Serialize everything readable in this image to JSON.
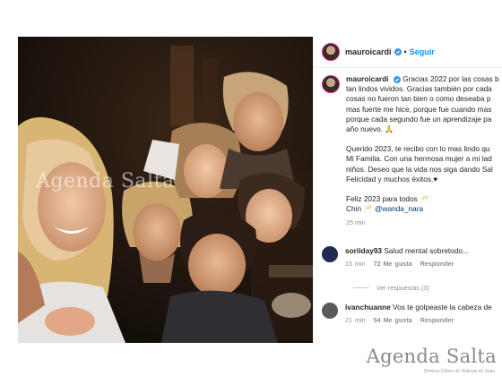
{
  "watermark": {
    "mid_text": "Agenda Salta",
    "logo_text": "Agenda Salta",
    "logo_sub": "Síntesis Online de Noticias de Salta"
  },
  "post": {
    "header": {
      "username": "mauroicardi",
      "separator": "•",
      "follow_label": "Seguir"
    },
    "caption": {
      "username": "mauroicardi",
      "lines_p1": [
        "Gracias 2022 por las cosas b",
        "tan lindos vividos. Gracias también por cada",
        "cosas no fueron tan bien o como deseaba p",
        "mas fuerte me hice, porque fue cuando mas",
        "porque cada segundo fue un aprendizaje pa",
        "año nuevo."
      ],
      "pray_emoji": "🙏",
      "lines_p2": [
        "Querido 2023, te recibo con lo mas lindo qu",
        "Mi Familia. Con una hermosa mujer a mi lad",
        "niños. Deseo que la vida nos siga dando Sal",
        "Felicidad y muchos éxitos.♥"
      ],
      "line_p3_1": "Feliz 2023 para todos",
      "line_p3_1_emoji": "🥂",
      "line_p3_2_prefix": "Chin",
      "line_p3_2_emoji": "🥂",
      "line_p3_2_mention": "@wanda_nara",
      "time": "25 min"
    },
    "comments": [
      {
        "username": "soriiday93",
        "text": "Salud mental sobretodo...",
        "time": "15 min",
        "likes": "72 Me gusta",
        "reply": "Responder",
        "avatar_color": "#1f2b52"
      },
      {
        "username": "ivanchuanne",
        "text": "Vos te golpeaste la cabeza de",
        "time": "21 min",
        "likes": "54 Me gusta",
        "reply": "Responder",
        "avatar_color": "#5a5a5a"
      }
    ],
    "view_replies": "Ver respuestas (3)"
  }
}
